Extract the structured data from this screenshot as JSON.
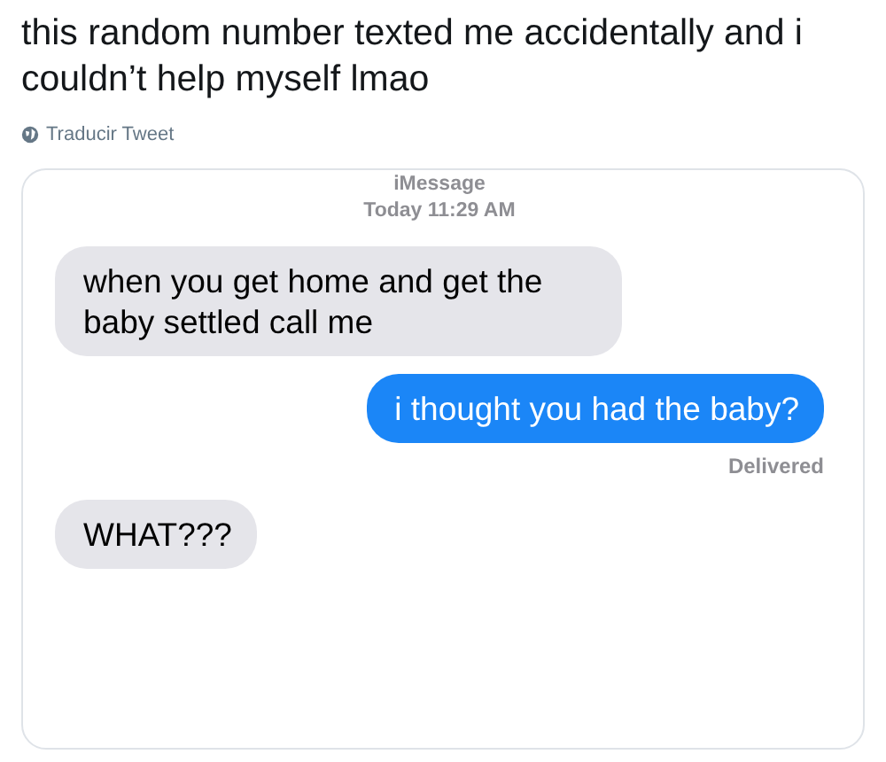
{
  "tweet": {
    "text": "this random number texted me accidentally and i couldn’t help myself lmao",
    "translate_link": "Traducir Tweet"
  },
  "conversation": {
    "service": "iMessage",
    "timestamp": "**Today** 11:29 AM",
    "messages": [
      {
        "kind": "received",
        "text": "when you get home and get the baby settled call me"
      },
      {
        "kind": "sent",
        "text": "i thought you had the baby?",
        "status": "Delivered"
      },
      {
        "kind": "received",
        "text": "WHAT???"
      }
    ]
  }
}
